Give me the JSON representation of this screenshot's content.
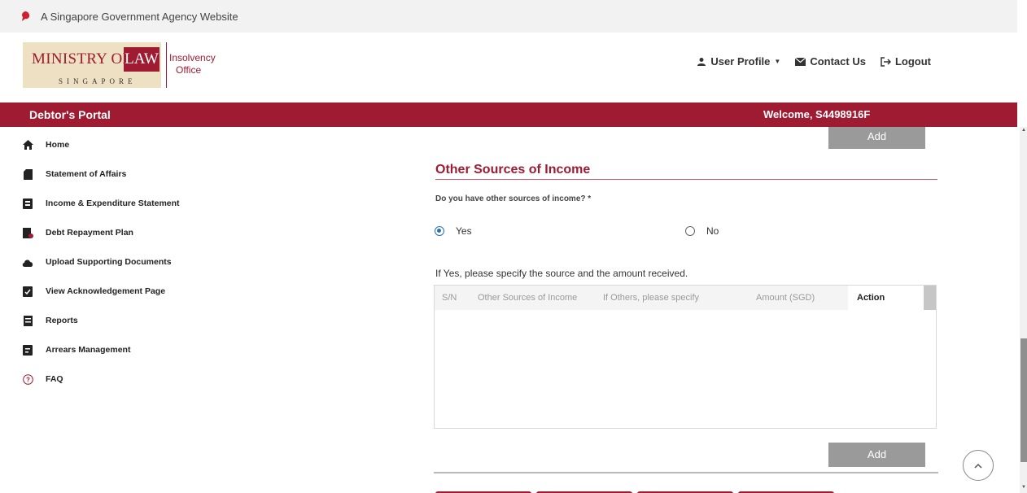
{
  "gov_bar": {
    "text": "A Singapore Government Agency Website"
  },
  "logo": {
    "ministry": "MINISTRY OF",
    "law": "LAW",
    "singapore": "SINGAPORE",
    "insolvency": "Insolvency",
    "office": "Office"
  },
  "top_nav": {
    "user_profile": "User Profile",
    "contact_us": "Contact Us",
    "logout": "Logout"
  },
  "title_bar": {
    "portal_title": "Debtor's Portal",
    "welcome": "Welcome, S4498916F"
  },
  "sidebar": {
    "items": [
      {
        "label": "Home",
        "icon": "home-icon"
      },
      {
        "label": "Statement of Affairs",
        "icon": "document-icon"
      },
      {
        "label": "Income & Expenditure Statement",
        "icon": "ledger-icon"
      },
      {
        "label": "Debt Repayment Plan",
        "icon": "payment-plan-icon"
      },
      {
        "label": "Upload Supporting Documents",
        "icon": "cloud-upload-icon"
      },
      {
        "label": "View Acknowledgement Page",
        "icon": "acknowledgement-icon"
      },
      {
        "label": "Reports",
        "icon": "report-icon"
      },
      {
        "label": "Arrears Management",
        "icon": "arrears-icon"
      },
      {
        "label": "FAQ",
        "icon": "question-icon"
      }
    ]
  },
  "main": {
    "add_top_label": "Add",
    "section_title": "Other Sources of Income",
    "question": "Do you have other sources of income? *",
    "radio_yes": "Yes",
    "radio_no": "No",
    "selected": "Yes",
    "instruction": "If Yes, please specify the source and the amount received.",
    "table": {
      "columns": [
        "S/N",
        "Other Sources of Income",
        "If Others, please specify",
        "Amount (SGD)",
        "Action"
      ],
      "rows": []
    },
    "add_bottom_label": "Add"
  },
  "colors": {
    "brand": "#9e1b32",
    "logo_bg": "#eee0c2",
    "button_grey": "#9a9a9a",
    "radio_blue": "#2a6fb8"
  }
}
